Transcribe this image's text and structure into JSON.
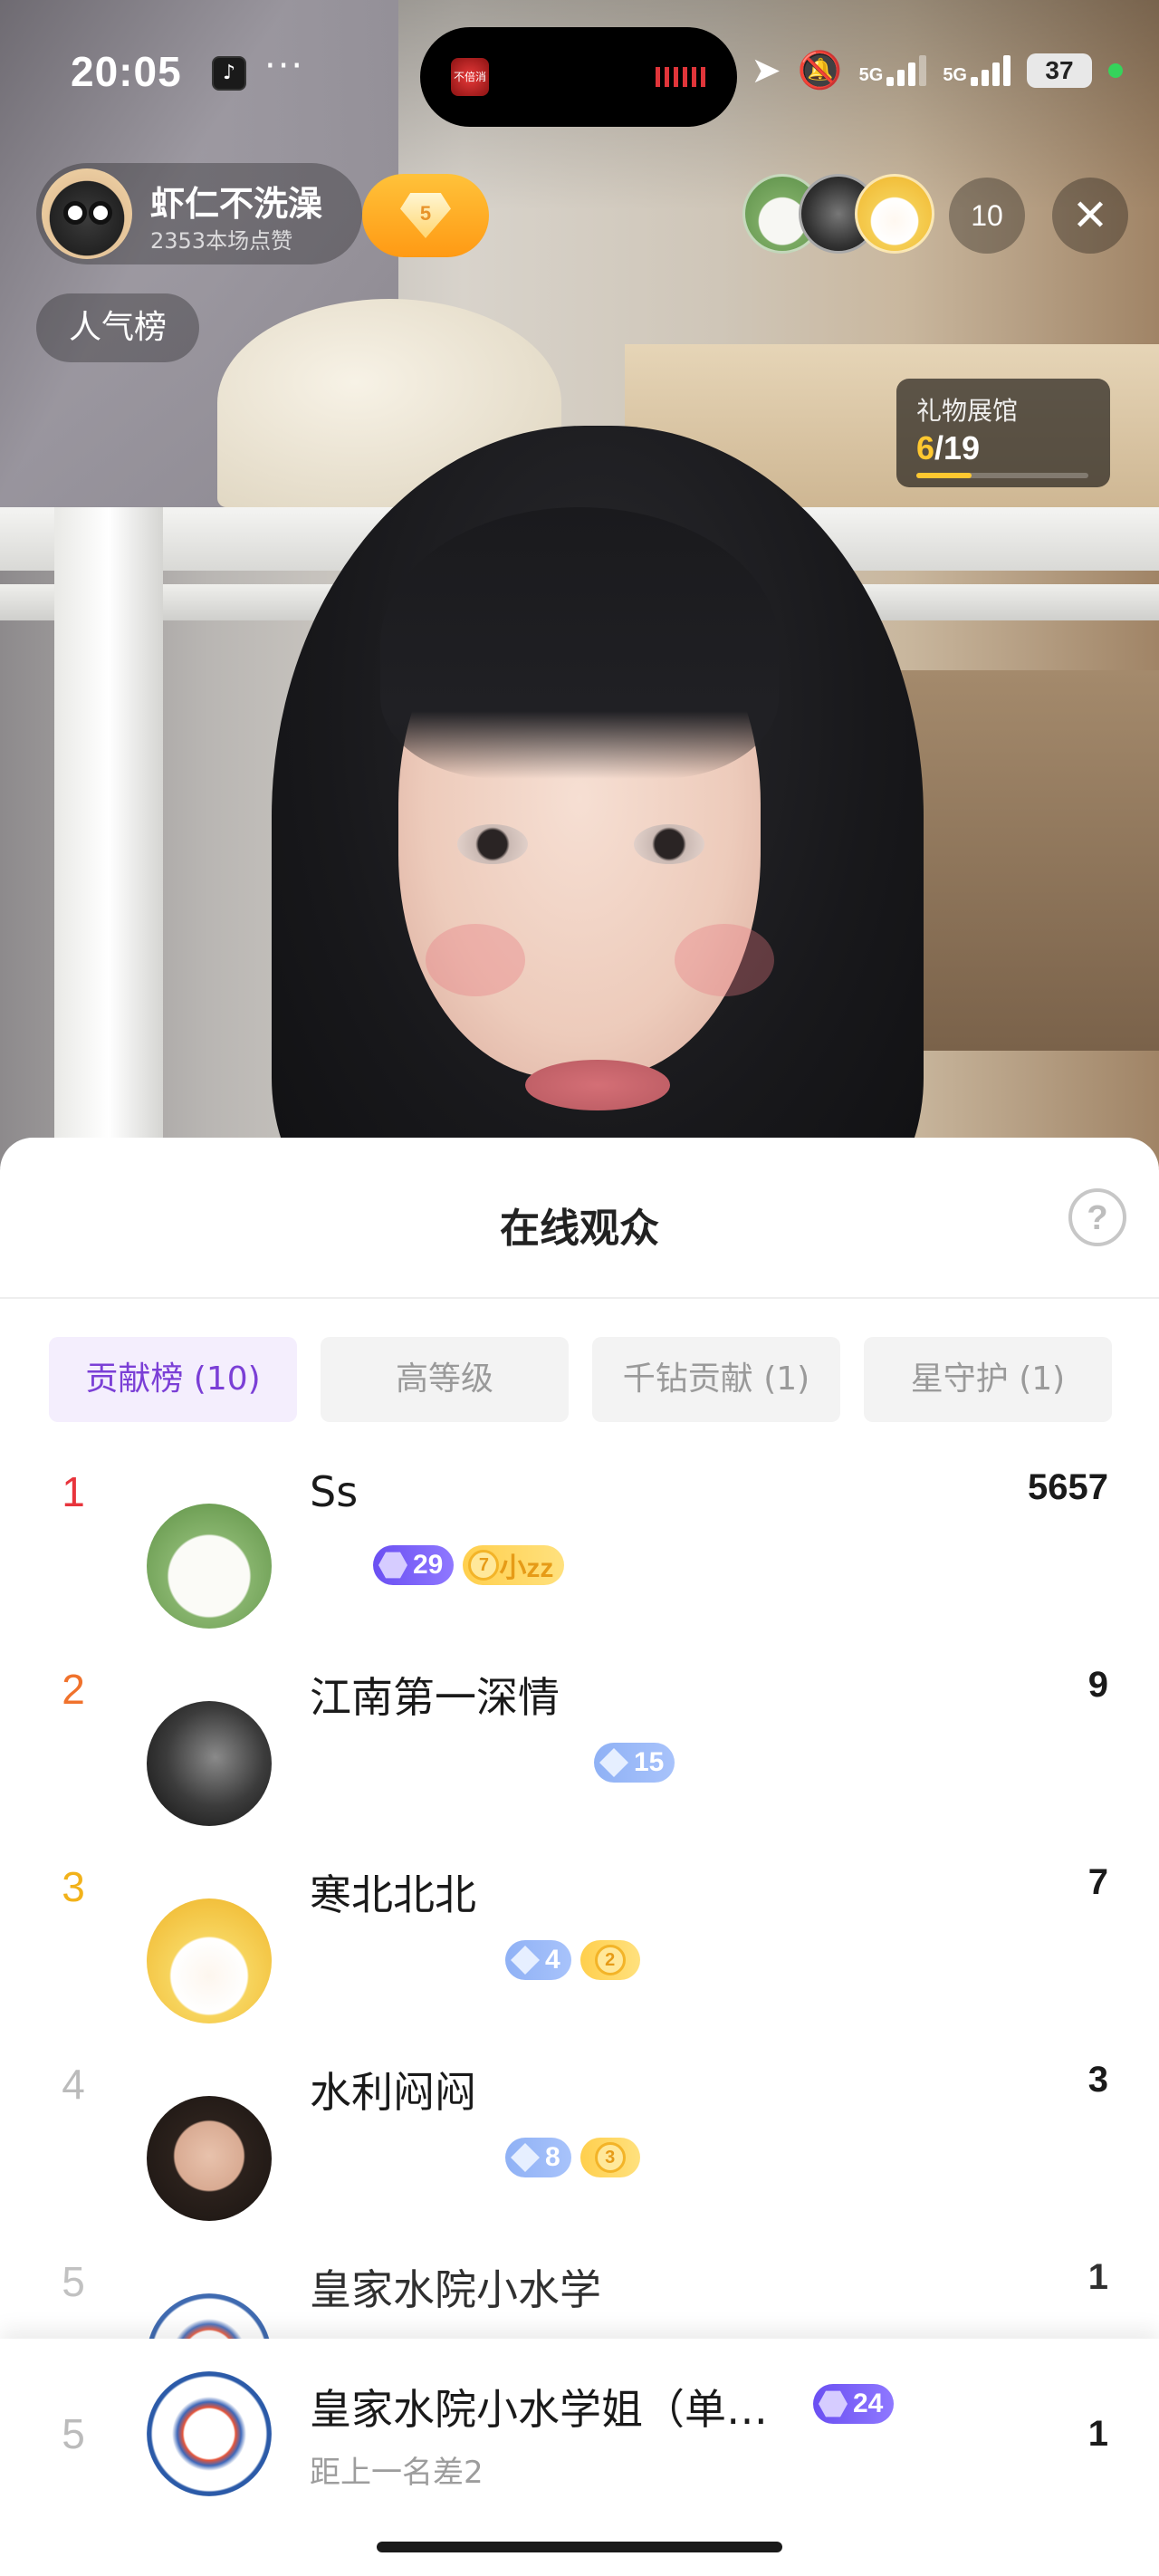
{
  "status_bar": {
    "time": "20:05",
    "more": "···",
    "network_1": "5G",
    "network_2": "5G",
    "battery": "37",
    "island_label": "不倍消"
  },
  "live": {
    "host_name": "虾仁不洗澡",
    "host_likes": "2353本场点赞",
    "fan_level": "5",
    "popularity_rank": "人气榜",
    "viewer_count": "10",
    "close": "✕",
    "gift_hall": {
      "title": "礼物展馆",
      "current": "6",
      "total": "/19",
      "progress": 0.32
    }
  },
  "sheet": {
    "title": "在线观众",
    "help": "?",
    "tabs": [
      {
        "label": "贡献榜 (10)",
        "active": true
      },
      {
        "label": "高等级",
        "active": false
      },
      {
        "label": "千钻贡献 (1)",
        "active": false
      },
      {
        "label": "星守护 (1)",
        "active": false
      }
    ],
    "rows": [
      {
        "rank": "1",
        "name": "Ss",
        "badge_level": "29",
        "club_level": "7",
        "club_name": "小zz",
        "score": "5657"
      },
      {
        "rank": "2",
        "name": "江南第一深情",
        "badge_level": "15",
        "score": "9"
      },
      {
        "rank": "3",
        "name": "寒北北北",
        "badge_level": "4",
        "fan_level": "2",
        "score": "7"
      },
      {
        "rank": "4",
        "name": "水利闷闷",
        "badge_level": "8",
        "fan_level": "3",
        "score": "3"
      },
      {
        "rank": "5",
        "name": "皇家水院小水学",
        "badge_level": "24",
        "score": "1"
      }
    ],
    "me": {
      "rank": "5",
      "name": "皇家水院小水学姐（单…",
      "badge_level": "24",
      "sub": "距上一名差2",
      "score": "1"
    }
  },
  "colors": {
    "accent_purple": "#7b3fd6",
    "rank1": "#e8343c",
    "rank2": "#f0722c",
    "rank3": "#f2b21a",
    "gold": "#ffc830"
  },
  "icons": [
    "tiktok-icon",
    "location-icon",
    "mute-bell-icon",
    "signal-icon",
    "battery-icon",
    "close-icon",
    "help-icon",
    "gem-icon",
    "diamond-icon",
    "hexagon-icon",
    "coin-icon"
  ]
}
